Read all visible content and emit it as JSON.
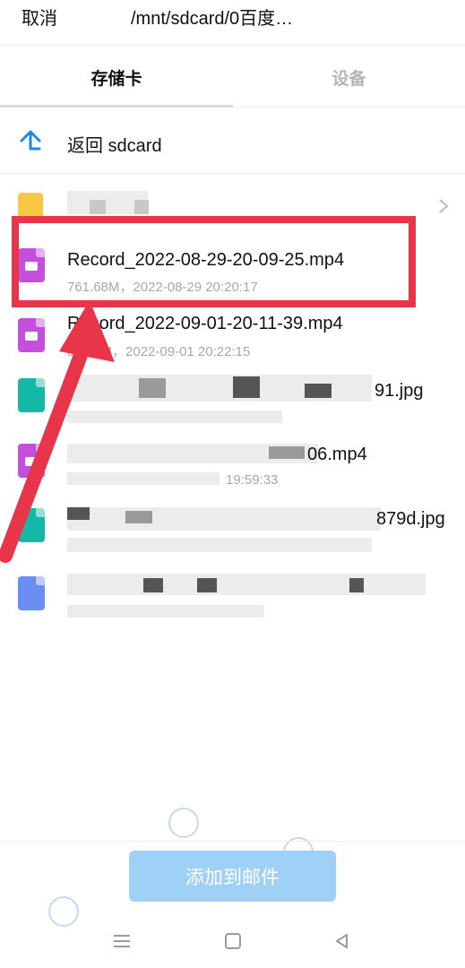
{
  "topbar": {
    "cancel_label": "取消",
    "path": "/mnt/sdcard/0百度…"
  },
  "tabs": [
    {
      "label": "存储卡",
      "active": true
    },
    {
      "label": "设备",
      "active": false
    }
  ],
  "back_row": {
    "label": "返回 sdcard",
    "icon": "up-arrow-icon"
  },
  "files": [
    {
      "name": "Record_2022-08-29-20-09-25.mp4",
      "meta": "761.68M，2022-08-29 20:20:17",
      "icon_color": "#c44fdc"
    },
    {
      "name": "Record_2022-09-01-20-11-39.mp4",
      "meta": "57.60M，2022-09-01 20:22:15",
      "icon_color": "#c44fdc"
    },
    {
      "name": "91.jpg",
      "meta": "",
      "icon_color": "#14b8a6"
    },
    {
      "name": "06.mp4",
      "meta": "19:59:33",
      "icon_color": "#c44fdc"
    },
    {
      "name": "879d.jpg",
      "meta": "",
      "icon_color": "#14b8a6"
    }
  ],
  "add_button_label": "添加到邮件",
  "colors": {
    "highlight": "#e8354a",
    "accent": "#1e88e5",
    "button": "#9fd0f5"
  },
  "nav": {
    "menu_icon": "menu-icon",
    "home_icon": "home-icon",
    "back_icon": "back-icon"
  }
}
